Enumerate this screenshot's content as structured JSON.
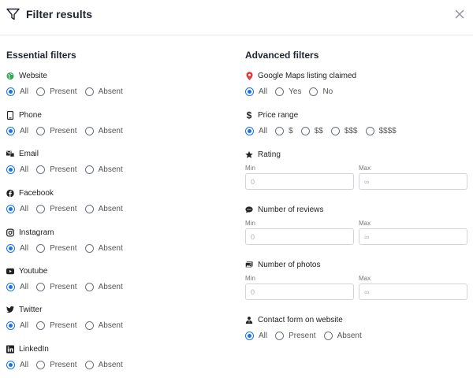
{
  "header": {
    "title": "Filter results"
  },
  "essential": {
    "title": "Essential filters",
    "groups": [
      {
        "label": "Website",
        "options": [
          "All",
          "Present",
          "Absent"
        ]
      },
      {
        "label": "Phone",
        "options": [
          "All",
          "Present",
          "Absent"
        ]
      },
      {
        "label": "Email",
        "options": [
          "All",
          "Present",
          "Absent"
        ]
      },
      {
        "label": "Facebook",
        "options": [
          "All",
          "Present",
          "Absent"
        ]
      },
      {
        "label": "Instagram",
        "options": [
          "All",
          "Present",
          "Absent"
        ]
      },
      {
        "label": "Youtube",
        "options": [
          "All",
          "Present",
          "Absent"
        ]
      },
      {
        "label": "Twitter",
        "options": [
          "All",
          "Present",
          "Absent"
        ]
      },
      {
        "label": "LinkedIn",
        "options": [
          "All",
          "Present",
          "Absent"
        ]
      }
    ]
  },
  "advanced": {
    "title": "Advanced filters",
    "gmaps": {
      "label": "Google Maps listing claimed",
      "options": [
        "All",
        "Yes",
        "No"
      ]
    },
    "price": {
      "label": "Price range",
      "options": [
        "All",
        "$",
        "$$",
        "$$$",
        "$$$$"
      ]
    },
    "rating": {
      "label": "Rating",
      "min_label": "Min",
      "max_label": "Max",
      "min_placeholder": "0",
      "max_placeholder": "∞"
    },
    "reviews": {
      "label": "Number of reviews",
      "min_label": "Min",
      "max_label": "Max",
      "min_placeholder": "0",
      "max_placeholder": "∞"
    },
    "photos": {
      "label": "Number of photos",
      "min_label": "Min",
      "max_label": "Max",
      "min_placeholder": "0",
      "max_placeholder": "∞"
    },
    "contact": {
      "label": "Contact form on website",
      "options": [
        "All",
        "Present",
        "Absent"
      ]
    }
  },
  "selected": "All",
  "colors": {
    "accent": "#1a73e8",
    "gmaps_pin": "#e53935",
    "website_icon": "#34a853"
  },
  "icons": [
    "filter-icon",
    "close-icon",
    "globe-icon",
    "phone-icon",
    "email-icon",
    "facebook-icon",
    "instagram-icon",
    "youtube-icon",
    "twitter-icon",
    "linkedin-icon",
    "map-pin-icon",
    "dollar-icon",
    "star-icon",
    "comment-icon",
    "photos-icon",
    "contact-icon"
  ]
}
